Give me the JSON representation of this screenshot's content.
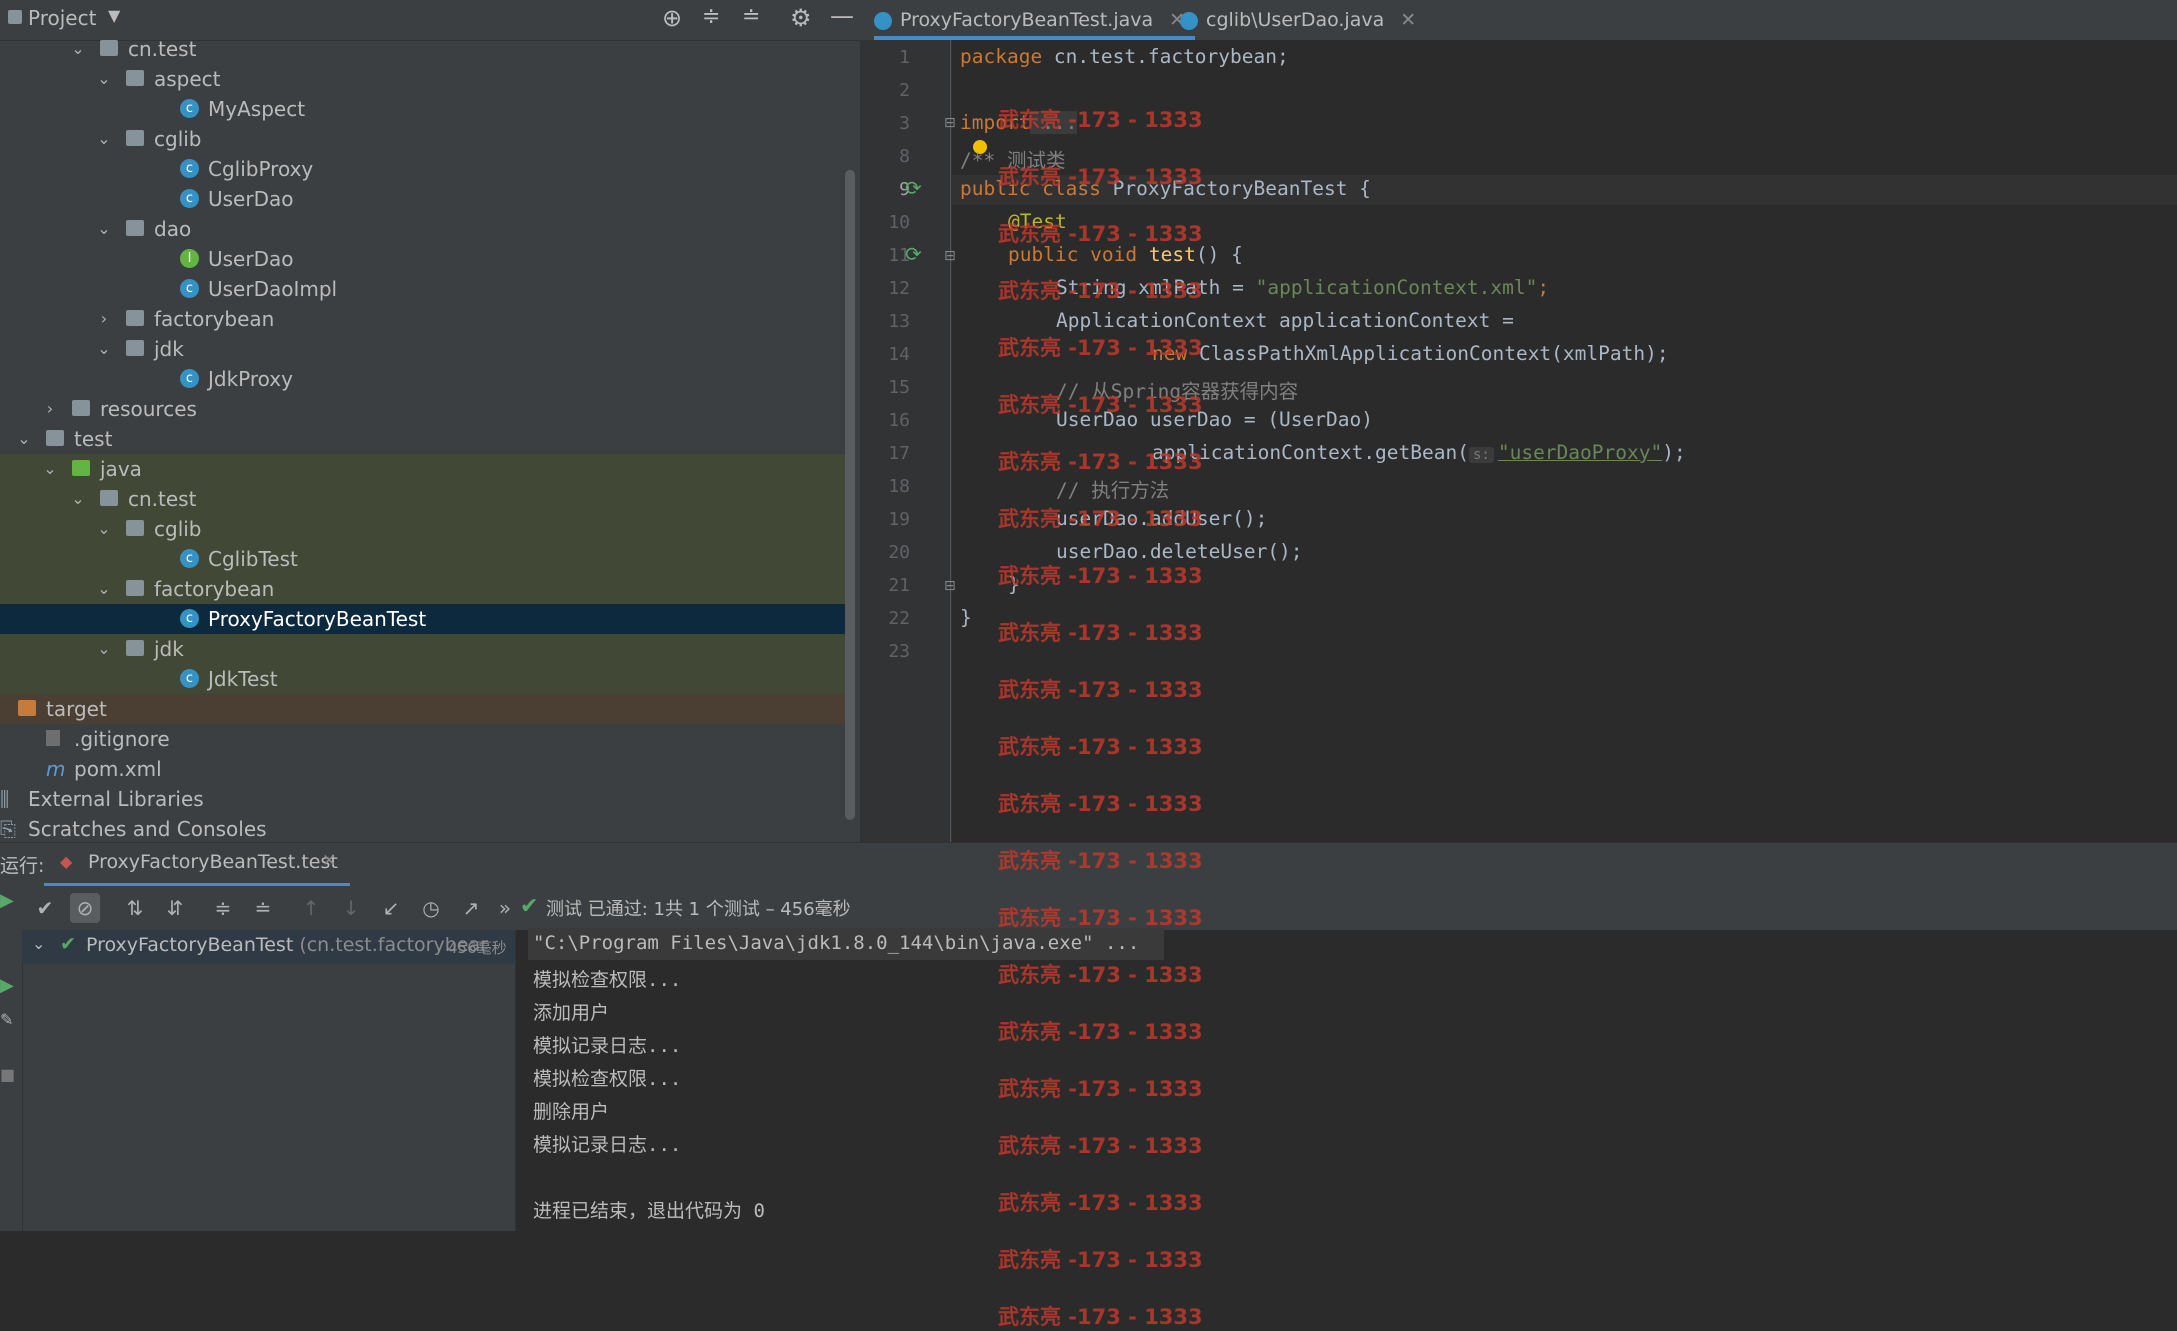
{
  "project": {
    "title": "Project",
    "tree": [
      {
        "label": "cn.test",
        "kind": "package",
        "open": true
      },
      {
        "label": "aspect",
        "kind": "package",
        "open": true
      },
      {
        "label": "MyAspect",
        "kind": "class"
      },
      {
        "label": "cglib",
        "kind": "package",
        "open": true
      },
      {
        "label": "CglibProxy",
        "kind": "class"
      },
      {
        "label": "UserDao",
        "kind": "class"
      },
      {
        "label": "dao",
        "kind": "package",
        "open": true
      },
      {
        "label": "UserDao",
        "kind": "interface"
      },
      {
        "label": "UserDaoImpl",
        "kind": "class"
      },
      {
        "label": "factorybean",
        "kind": "package",
        "open": false
      },
      {
        "label": "jdk",
        "kind": "package",
        "open": true
      },
      {
        "label": "JdkProxy",
        "kind": "class"
      },
      {
        "label": "resources",
        "kind": "resources",
        "open": false
      },
      {
        "label": "test",
        "kind": "folder",
        "open": true
      },
      {
        "label": "java",
        "kind": "test-root",
        "open": true
      },
      {
        "label": "cn.test",
        "kind": "package",
        "open": true
      },
      {
        "label": "cglib",
        "kind": "package",
        "open": true
      },
      {
        "label": "CglibTest",
        "kind": "test-class"
      },
      {
        "label": "factorybean",
        "kind": "package",
        "open": true
      },
      {
        "label": "ProxyFactoryBeanTest",
        "kind": "test-class",
        "selected": true
      },
      {
        "label": "jdk",
        "kind": "package",
        "open": true
      },
      {
        "label": "JdkTest",
        "kind": "test-class"
      },
      {
        "label": "target",
        "kind": "excluded",
        "open": false
      },
      {
        "label": ".gitignore",
        "kind": "file"
      },
      {
        "label": "pom.xml",
        "kind": "maven"
      },
      {
        "label": "External Libraries",
        "kind": "libraries",
        "open": false
      },
      {
        "label": "Scratches and Consoles",
        "kind": "scratches"
      }
    ]
  },
  "editor": {
    "tabs": [
      {
        "label": "ProxyFactoryBeanTest.java",
        "active": true
      },
      {
        "label": "cglib\\UserDao.java",
        "active": false
      }
    ],
    "line_numbers": [
      "1",
      "2",
      "3",
      "8",
      "9",
      "10",
      "11",
      "12",
      "13",
      "14",
      "15",
      "16",
      "17",
      "18",
      "19",
      "20",
      "21",
      "22",
      "23"
    ],
    "code": {
      "l1_kw": "package",
      "l1_rest": " cn.test.factorybean;",
      "l3_kw": "import",
      "l3_rest": " ...",
      "l8": "/** 测试类",
      "l9_kw": "public class",
      "l9_name": " ProxyFactoryBeanTest {",
      "l10": "@Test",
      "l11_kw": "public void",
      "l11_fn": " test",
      "l11_rest": "() {",
      "l12_a": "String xmlPath = ",
      "l12_str": "\"applicationContext.xml\"",
      "l12_b": ";",
      "l13": "ApplicationContext applicationContext =",
      "l14_kw": "new",
      "l14_rest": " ClassPathXmlApplicationContext(xmlPath);",
      "l15": "// 从Spring容器获得内容",
      "l16": "UserDao userDao = (UserDao)",
      "l17_a": "applicationContext.getBean(",
      "l17_hint": "s:",
      "l17_str": "\"userDaoProxy\"",
      "l17_b": ");",
      "l18": "// 执行方法",
      "l19": "userDao.addUser();",
      "l20": "userDao.deleteUser();",
      "l21": "}",
      "l22": "}"
    }
  },
  "run": {
    "label": "运行:",
    "tab": "ProxyFactoryBeanTest.test",
    "status": "测试 已通过: 1共 1 个测试 – 456毫秒",
    "test_name": "ProxyFactoryBeanTest",
    "test_pkg": " (cn.test.factorybear",
    "test_time": "456毫秒",
    "console": [
      "\"C:\\Program Files\\Java\\jdk1.8.0_144\\bin\\java.exe\" ...",
      "模拟检查权限...",
      "添加用户",
      "模拟记录日志...",
      "模拟检查权限...",
      "删除用户",
      "模拟记录日志...",
      "",
      "进程已结束，退出代码为 0"
    ]
  },
  "watermark": "武东亮 -173 - 1333",
  "colors": {
    "accent": "#4a88c7",
    "keyword": "#cc7832",
    "string": "#6a8759",
    "watermark": "#c0392b"
  }
}
